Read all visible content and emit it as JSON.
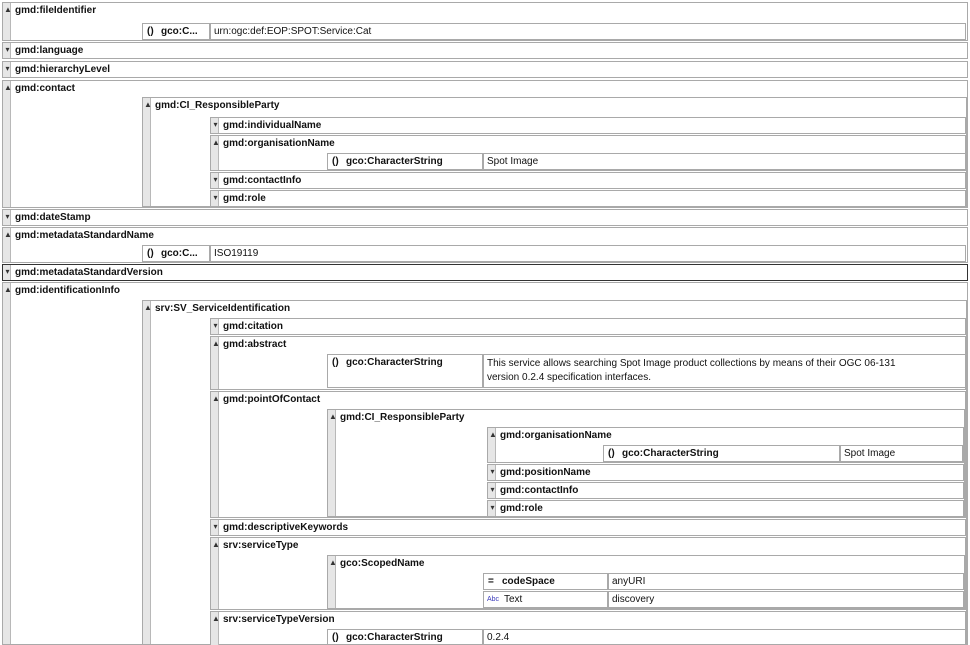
{
  "icons": {
    "expanded": "▲",
    "collapsed": "▾",
    "element": "()",
    "attribute": "=",
    "text": "Abc"
  },
  "colors": {
    "border": "#a9a9a9",
    "gutter": "#e6e6e6",
    "text_icon": "#3b3bbb"
  },
  "tree": {
    "file_identifier": {
      "label": "gmd:fileIdentifier",
      "type": "gco:C...",
      "value": "urn:ogc:def:EOP:SPOT:Service:Cat"
    },
    "language": {
      "label": "gmd:language"
    },
    "hierarchy_level": {
      "label": "gmd:hierarchyLevel"
    },
    "contact": {
      "label": "gmd:contact",
      "party": "gmd:CI_ResponsibleParty",
      "individual_name": "gmd:individualName",
      "organisation_name": "gmd:organisationName",
      "org_type": "gco:CharacterString",
      "org_value": "Spot Image",
      "contact_info": "gmd:contactInfo",
      "role": "gmd:role"
    },
    "date_stamp": {
      "label": "gmd:dateStamp"
    },
    "metadata_standard_name": {
      "label": "gmd:metadataStandardName",
      "type": "gco:C...",
      "value": "ISO19119"
    },
    "metadata_standard_version": {
      "label": "gmd:metadataStandardVersion"
    },
    "identification_info": {
      "label": "gmd:identificationInfo",
      "service_identification": "srv:SV_ServiceIdentification",
      "citation": "gmd:citation",
      "abstract": {
        "label": "gmd:abstract",
        "type": "gco:CharacterString",
        "value_line1": "This service allows searching Spot Image product collections by means of their OGC 06-131",
        "value_line2": "version 0.2.4 specification interfaces."
      },
      "point_of_contact": {
        "label": "gmd:pointOfContact",
        "party": "gmd:CI_ResponsibleParty",
        "organisation_name": "gmd:organisationName",
        "org_type": "gco:CharacterString",
        "org_value": "Spot Image",
        "position_name": "gmd:positionName",
        "contact_info": "gmd:contactInfo",
        "role": "gmd:role"
      },
      "descriptive_keywords": "gmd:descriptiveKeywords",
      "service_type": {
        "label": "srv:serviceType",
        "scoped_name": "gco:ScopedName",
        "attr_name": "codeSpace",
        "attr_value": "anyURI",
        "text_label": "Text",
        "text_value": "discovery"
      },
      "service_type_version": {
        "label": "srv:serviceTypeVersion",
        "type": "gco:CharacterString",
        "value": "0.2.4"
      }
    }
  }
}
